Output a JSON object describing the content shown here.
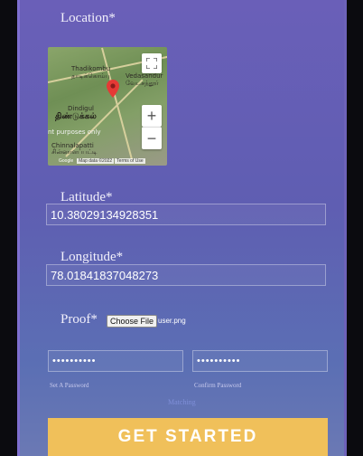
{
  "location": {
    "label": "Location*"
  },
  "map": {
    "place_labels": [
      "Thadikombu",
      "தாடிக்கொம்பு",
      "Vedasandur",
      "வேடசந்தூர்",
      "Dindigul",
      "திண்டுக்கல்",
      "Chinnalapatti",
      "சின்னாளப்பட்டி"
    ],
    "watermark": "nt purposes only",
    "footer_credit": "Map data ©2022",
    "footer_terms": "Terms of Use",
    "logo": "Google"
  },
  "latitude": {
    "label": "Latitude*",
    "value": "10.38029134928351"
  },
  "longitude": {
    "label": "Longitude*",
    "value": "78.01841837048273"
  },
  "proof": {
    "label": "Proof*",
    "button": "Choose File",
    "file": "user.png"
  },
  "password": {
    "value": "••••••••••",
    "label": "Set A Password"
  },
  "confirm": {
    "value": "••••••••••",
    "label": "Confirm Password"
  },
  "match_text": "Matching",
  "cta": {
    "label": "GET STARTED"
  },
  "colors": {
    "accent": "#f0c05a",
    "panel": "#6366b6"
  }
}
